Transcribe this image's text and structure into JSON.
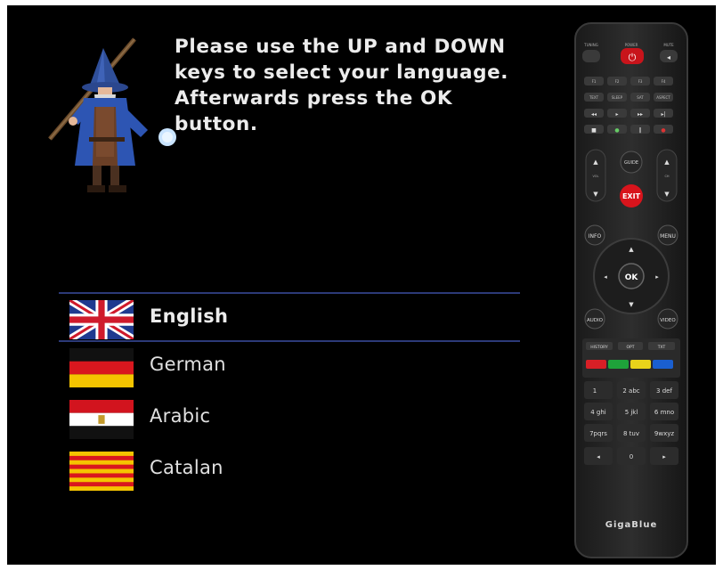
{
  "instructions": {
    "line1": "Please use the UP and DOWN",
    "line2": "keys to select your language.",
    "line3": "Afterwards press the OK",
    "line4": "button."
  },
  "languages": [
    {
      "label": "English",
      "flag": "uk-flag-icon",
      "selected": true
    },
    {
      "label": "German",
      "flag": "germany-flag-icon",
      "selected": false
    },
    {
      "label": "Arabic",
      "flag": "egypt-flag-icon",
      "selected": false
    },
    {
      "label": "Catalan",
      "flag": "catalonia-flag-icon",
      "selected": false
    }
  ],
  "remote": {
    "brand": "GigaBlue",
    "tuning_label": "TUNING",
    "power_label": "POWER",
    "mute_label": "MUTE",
    "f_keys": [
      "F1",
      "F2",
      "F3",
      "F4"
    ],
    "mode_keys": [
      "TEXT",
      "SLEEP",
      "SAT",
      "ASPECT"
    ],
    "guide": "GUIDE",
    "exit": "EXIT",
    "vol": "VOL",
    "ch": "CH",
    "info": "INFO",
    "menu": "MENU",
    "ok": "OK",
    "audio": "AUDIO",
    "video": "VIDEO",
    "history": "HISTORY",
    "opt": "OPT",
    "txt": "TXT",
    "numpad": [
      "1",
      "2 abc",
      "3 def",
      "4 ghi",
      "5 jkl",
      "6 mno",
      "7pqrs",
      "8 tuv",
      "9wxyz"
    ],
    "zero": "0"
  },
  "colors": {
    "background": "#000000",
    "selection_line": "#2c3a78",
    "text": "#ececec",
    "exit_red": "#d8141c",
    "color_keys": [
      "#d81f26",
      "#1ea33a",
      "#e9d31a",
      "#1a5fd0"
    ]
  }
}
